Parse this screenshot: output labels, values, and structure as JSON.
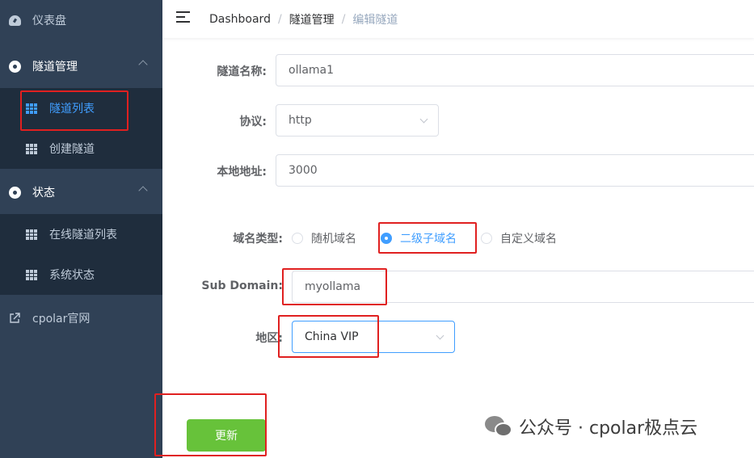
{
  "sidebar": {
    "dashboard": "仪表盘",
    "tunnel_mgmt": "隧道管理",
    "tunnel_list": "隧道列表",
    "create_tunnel": "创建隧道",
    "status": "状态",
    "online_tunnels": "在线隧道列表",
    "system_status": "系统状态",
    "official_site": "cpolar官网"
  },
  "breadcrumb": [
    "Dashboard",
    "隧道管理",
    "编辑隧道"
  ],
  "form": {
    "name_label": "隧道名称:",
    "name_value": "ollama1",
    "protocol_label": "协议:",
    "protocol_value": "http",
    "local_addr_label": "本地地址:",
    "local_addr_value": "3000",
    "domain_type_label": "域名类型:",
    "domain_types": [
      "随机域名",
      "二级子域名",
      "自定义域名"
    ],
    "domain_type_selected": "二级子域名",
    "subdomain_label": "Sub Domain:",
    "subdomain_value": "myollama",
    "region_label": "地区:",
    "region_value": "China VIP",
    "update_button": "更新"
  },
  "watermark": "公众号 · cpolar极点云",
  "colors": {
    "sidebar_bg": "#304156",
    "submenu_bg": "#1f2d3d",
    "accent": "#409eff",
    "success": "#67c23a",
    "highlight": "#e02020"
  }
}
